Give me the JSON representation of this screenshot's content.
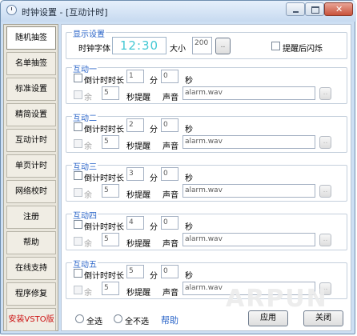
{
  "window": {
    "title": "时钟设置 - [互动计时]"
  },
  "sidebar": {
    "items": [
      {
        "label": "随机抽签"
      },
      {
        "label": "名单抽签"
      },
      {
        "label": "标准设置"
      },
      {
        "label": "精简设置"
      },
      {
        "label": "互动计时"
      },
      {
        "label": "单页计时"
      },
      {
        "label": "网络校时"
      },
      {
        "label": "注册"
      },
      {
        "label": "帮助"
      },
      {
        "label": "在线支持"
      },
      {
        "label": "程序修复"
      },
      {
        "label": "安装VSTO版"
      }
    ]
  },
  "display": {
    "legend": "显示设置",
    "font_label": "时钟字体",
    "clock_preview": "12:30",
    "size_label": "大小",
    "size_value": "200",
    "browse_label": "..",
    "flash_label": "提醒后闪烁"
  },
  "groups": [
    {
      "legend": "互动一",
      "countdown_label": "倒计时时长",
      "minutes": "1",
      "min_unit": "分",
      "seconds": "0",
      "sec_unit": "秒",
      "remain_label": "余",
      "remind_seconds": "5",
      "remind_label": "秒提醒",
      "sound_label": "声音",
      "sound_file": "alarm.wav",
      "browse_label": ".."
    },
    {
      "legend": "互动二",
      "countdown_label": "倒计时时长",
      "minutes": "2",
      "min_unit": "分",
      "seconds": "0",
      "sec_unit": "秒",
      "remain_label": "余",
      "remind_seconds": "5",
      "remind_label": "秒提醒",
      "sound_label": "声音",
      "sound_file": "alarm.wav",
      "browse_label": ".."
    },
    {
      "legend": "互动三",
      "countdown_label": "倒计时时长",
      "minutes": "3",
      "min_unit": "分",
      "seconds": "0",
      "sec_unit": "秒",
      "remain_label": "余",
      "remind_seconds": "5",
      "remind_label": "秒提醒",
      "sound_label": "声音",
      "sound_file": "alarm.wav",
      "browse_label": ".."
    },
    {
      "legend": "互动四",
      "countdown_label": "倒计时时长",
      "minutes": "4",
      "min_unit": "分",
      "seconds": "0",
      "sec_unit": "秒",
      "remain_label": "余",
      "remind_seconds": "5",
      "remind_label": "秒提醒",
      "sound_label": "声音",
      "sound_file": "alarm.wav",
      "browse_label": ".."
    },
    {
      "legend": "互动五",
      "countdown_label": "倒计时时长",
      "minutes": "5",
      "min_unit": "分",
      "seconds": "0",
      "sec_unit": "秒",
      "remain_label": "余",
      "remind_seconds": "5",
      "remind_label": "秒提醒",
      "sound_label": "声音",
      "sound_file": "alarm.wav",
      "browse_label": ".."
    }
  ],
  "footer": {
    "select_all": "全选",
    "select_none": "全不选",
    "help": "帮助",
    "apply": "应用",
    "close": "关闭"
  },
  "watermark": "ARPUN",
  "colors": {
    "accent_blue": "#2a64c8",
    "clock_cyan": "#44c8d4",
    "vsto_red": "#cc1111"
  }
}
